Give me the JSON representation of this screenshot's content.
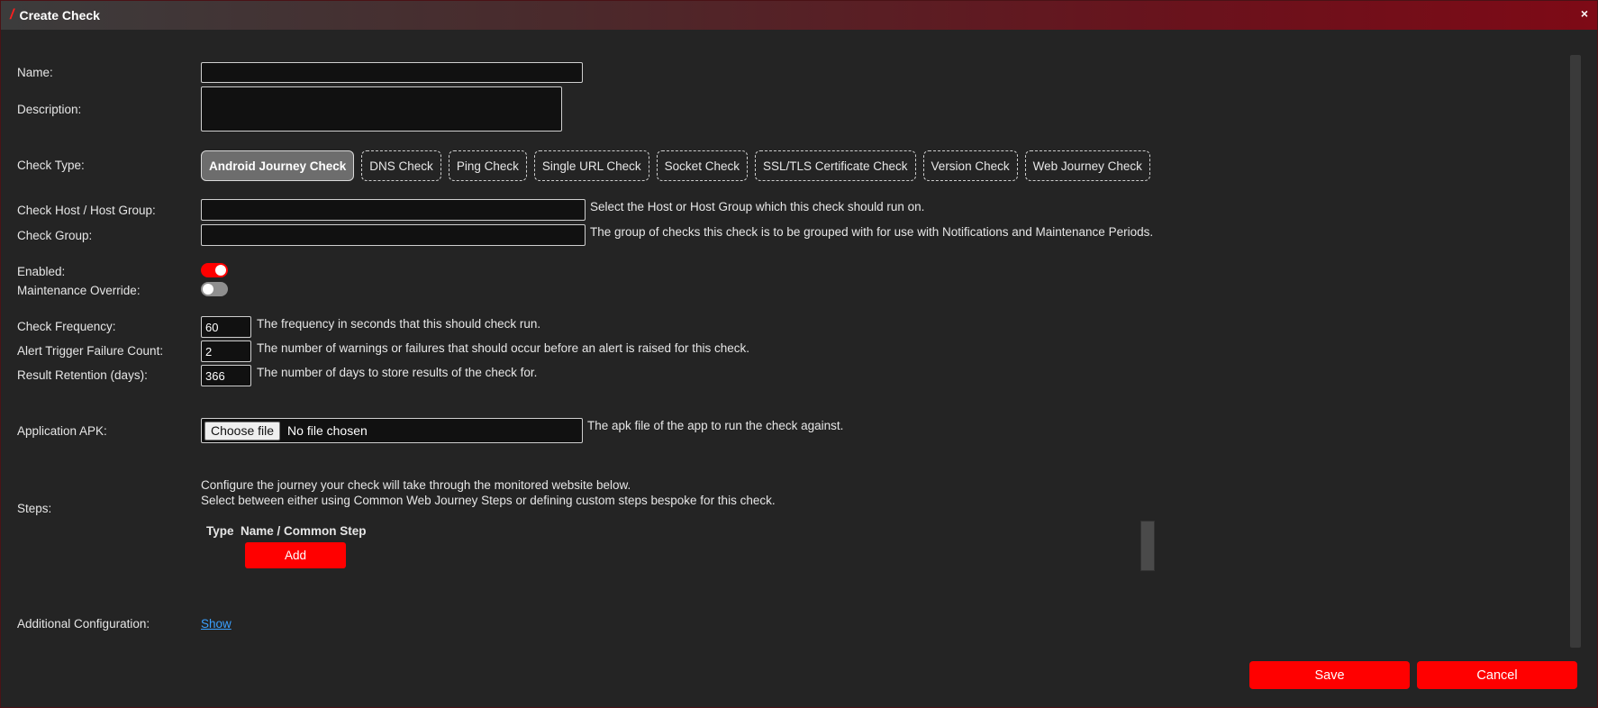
{
  "window": {
    "title": "Create Check",
    "close_label": "×"
  },
  "form": {
    "name_label": "Name:",
    "name_value": "",
    "description_label": "Description:",
    "description_value": "",
    "check_type_label": "Check Type:",
    "check_types": [
      {
        "label": "Android Journey Check",
        "active": true
      },
      {
        "label": "DNS Check",
        "active": false
      },
      {
        "label": "Ping Check",
        "active": false
      },
      {
        "label": "Single URL Check",
        "active": false
      },
      {
        "label": "Socket Check",
        "active": false
      },
      {
        "label": "SSL/TLS Certificate Check",
        "active": false
      },
      {
        "label": "Version Check",
        "active": false
      },
      {
        "label": "Web Journey Check",
        "active": false
      }
    ],
    "host_label": "Check Host / Host Group:",
    "host_value": "",
    "host_hint": "Select the Host or Host Group which this check should run on.",
    "group_label": "Check Group:",
    "group_value": "",
    "group_hint": "The group of checks this check is to be grouped with for use with Notifications and Maintenance Periods.",
    "enabled_label": "Enabled:",
    "enabled": true,
    "maintenance_label": "Maintenance Override:",
    "maintenance_override": false,
    "frequency_label": "Check Frequency:",
    "frequency_value": "60",
    "frequency_hint": "The frequency in seconds that this should check run.",
    "failure_label": "Alert Trigger Failure Count:",
    "failure_value": "2",
    "failure_hint": "The number of warnings or failures that should occur before an alert is raised for this check.",
    "retention_label": "Result Retention (days):",
    "retention_value": "366",
    "retention_hint": "The number of days to store results of the check for.",
    "apk_label": "Application APK:",
    "apk_button": "Choose file",
    "apk_status": "No file chosen",
    "apk_hint": "The apk file of the app to run the check against.",
    "steps_label": "Steps:",
    "steps_desc_line1": "Configure the journey your check will take through the monitored website below.",
    "steps_desc_line2": "Select between either using Common Web Journey Steps or defining custom steps bespoke for this check.",
    "steps_col_type": "Type",
    "steps_col_name": "Name / Common Step",
    "steps_add": "Add",
    "additional_label": "Additional Configuration:",
    "additional_link": "Show"
  },
  "footer": {
    "save": "Save",
    "cancel": "Cancel"
  },
  "colors": {
    "accent": "#ff0000",
    "link": "#3aa0ff",
    "background": "#242424"
  }
}
